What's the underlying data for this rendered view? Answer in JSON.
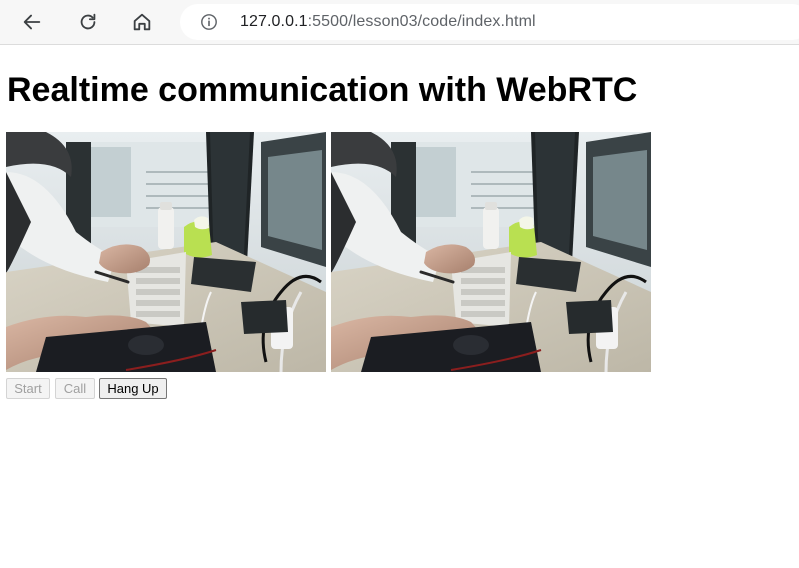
{
  "browser": {
    "url_host": "127.0.0.1",
    "url_path": ":5500/lesson03/code/index.html",
    "icons": {
      "back": "arrow-left-icon",
      "reload": "reload-icon",
      "home": "home-icon",
      "info": "info-icon"
    }
  },
  "page": {
    "title": "Realtime communication with WebRTC",
    "videos": [
      {
        "role": "local-video",
        "content": "webcam feed: person typing on keyboard and using mouse at desk"
      },
      {
        "role": "remote-video",
        "content": "webcam feed: person typing on keyboard and using mouse at desk"
      }
    ],
    "buttons": {
      "start": {
        "label": "Start",
        "enabled": false
      },
      "call": {
        "label": "Call",
        "enabled": false
      },
      "hangup": {
        "label": "Hang Up",
        "enabled": true
      }
    }
  },
  "colors": {
    "toolbar_bg": "#f7f7f7",
    "title_text": "#000000",
    "disabled_text": "#a0a0a0"
  }
}
